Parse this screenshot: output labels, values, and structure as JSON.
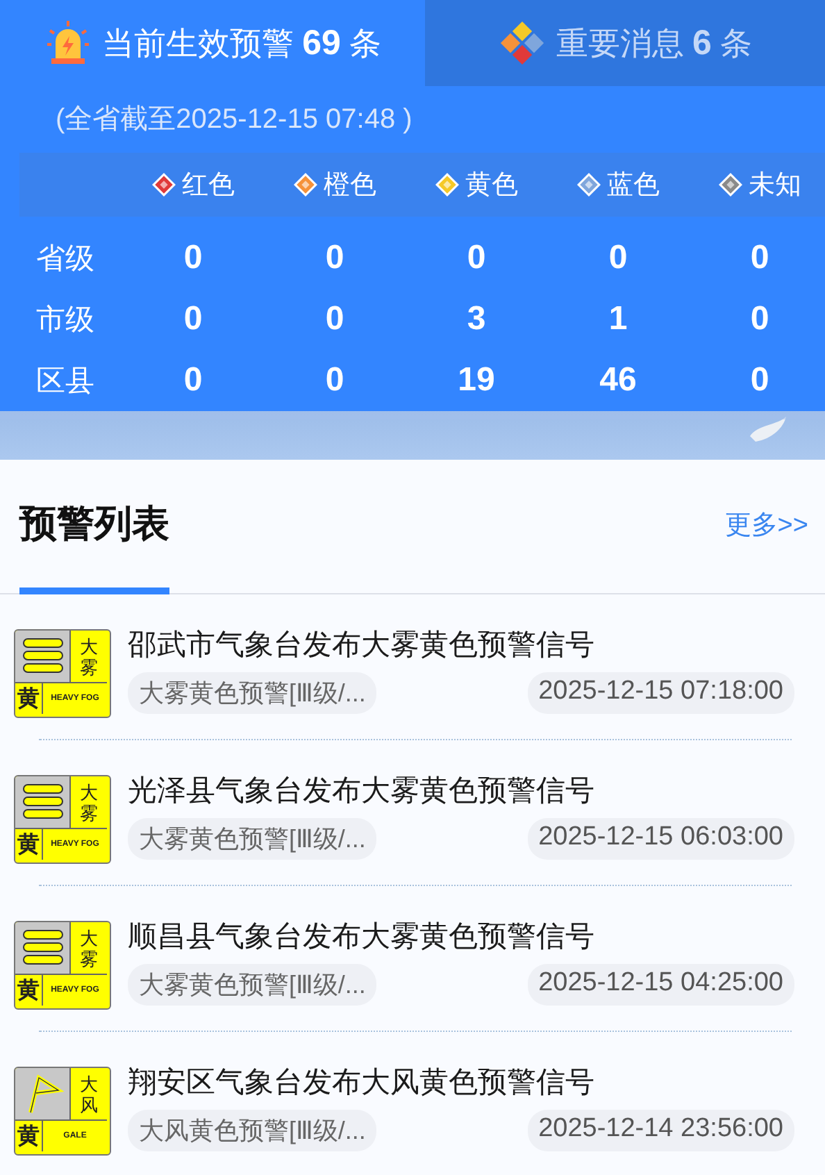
{
  "tabs": [
    {
      "kind": "alarm",
      "label": "当前生效预警",
      "count": "69",
      "unit": "条",
      "selected": true
    },
    {
      "kind": "news",
      "label": "重要消息",
      "count": "6",
      "unit": "条",
      "selected": false
    }
  ],
  "as_of": "(全省截至2025-12-15 07:48 )",
  "levels": [
    {
      "label": "红色",
      "color": "#e03a3a"
    },
    {
      "label": "橙色",
      "color": "#f5923a"
    },
    {
      "label": "黄色",
      "color": "#f5c928"
    },
    {
      "label": "蓝色",
      "color": "#7fa6dc"
    },
    {
      "label": "未知",
      "color": "#8a8a8a"
    }
  ],
  "stats": [
    {
      "label": "省级",
      "values": [
        "0",
        "0",
        "0",
        "0",
        "0"
      ]
    },
    {
      "label": "市级",
      "values": [
        "0",
        "0",
        "3",
        "1",
        "0"
      ]
    },
    {
      "label": "区县",
      "values": [
        "0",
        "0",
        "19",
        "46",
        "0"
      ]
    }
  ],
  "list": {
    "title": "预警列表",
    "more": "更多>>",
    "items": [
      {
        "title": "邵武市气象台发布大雾黄色预警信号",
        "tag": "大雾黄色预警[Ⅲ级/...",
        "time": "2025-12-15 07:18:00",
        "icon": {
          "kind": "fog",
          "name_top": "大",
          "name_bottom": "雾",
          "level": "黄",
          "english": "HEAVY FOG"
        }
      },
      {
        "title": "光泽县气象台发布大雾黄色预警信号",
        "tag": "大雾黄色预警[Ⅲ级/...",
        "time": "2025-12-15 06:03:00",
        "icon": {
          "kind": "fog",
          "name_top": "大",
          "name_bottom": "雾",
          "level": "黄",
          "english": "HEAVY FOG"
        }
      },
      {
        "title": "顺昌县气象台发布大雾黄色预警信号",
        "tag": "大雾黄色预警[Ⅲ级/...",
        "time": "2025-12-15 04:25:00",
        "icon": {
          "kind": "fog",
          "name_top": "大",
          "name_bottom": "雾",
          "level": "黄",
          "english": "HEAVY FOG"
        }
      },
      {
        "title": "翔安区气象台发布大风黄色预警信号",
        "tag": "大风黄色预警[Ⅲ级/...",
        "time": "2025-12-14 23:56:00",
        "icon": {
          "kind": "gale",
          "name_top": "大",
          "name_bottom": "风",
          "level": "黄",
          "english": "GALE"
        }
      }
    ]
  }
}
